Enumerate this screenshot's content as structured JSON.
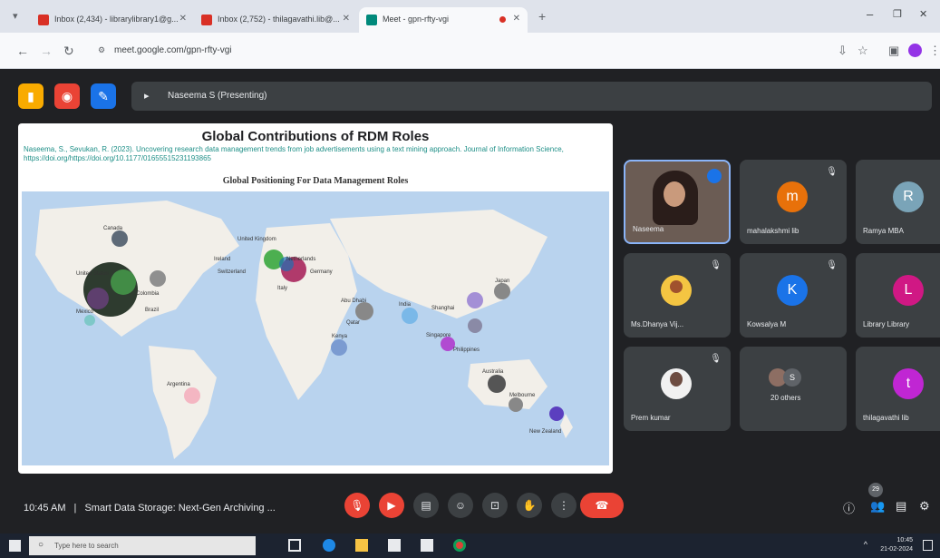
{
  "browser": {
    "tabs": [
      {
        "label": "Inbox (2,434) - librarylibrary1@g...",
        "active": false
      },
      {
        "label": "Inbox (2,752) - thilagavathi.lib@...",
        "active": false
      },
      {
        "label": "Meet - gpn-rfty-vgi",
        "active": true
      }
    ],
    "url": "meet.google.com/gpn-rfty-vgi"
  },
  "meet": {
    "presenter": "Naseema S (Presenting)",
    "meeting_time": "10:45 AM",
    "meeting_title": "Smart Data Storage: Next-Gen Archiving ...",
    "participant_count": "29"
  },
  "slide": {
    "title": "Global Contributions of RDM Roles",
    "citation": "Naseema, S., Sevukan, R. (2023). Uncovering research data management trends from job advertisements using a text mining approach. Journal of Information Science, https://doi.org/https://doi.org/10.1177/01655515231193865",
    "map_title": "Global Positioning For Data Management Roles",
    "map_labels": [
      "Canada",
      "United States",
      "Mexico",
      "Colombia",
      "Brazil",
      "United Kingdom",
      "Ireland",
      "Switzerland",
      "Netherlands",
      "Germany",
      "Italy",
      "Abu Dhabi",
      "Qatar",
      "Kenya",
      "India",
      "Shanghai",
      "Japan",
      "Singapore",
      "Philippines",
      "Australia",
      "Melbourne",
      "New Zealand",
      "Argentina"
    ]
  },
  "participants": [
    {
      "name": "Naseema",
      "initial": "",
      "color": "#ffffff",
      "type": "video"
    },
    {
      "name": "mahalakshmi lib",
      "initial": "m",
      "color": "#e8710a",
      "type": "avatar"
    },
    {
      "name": "Ramya MBA",
      "initial": "R",
      "color": "#7aa4b8",
      "type": "avatar"
    },
    {
      "name": "Ms.Dhanya Vij...",
      "initial": "",
      "color": "#e0e0e0",
      "type": "photo"
    },
    {
      "name": "Kowsalya M",
      "initial": "K",
      "color": "#1a73e8",
      "type": "avatar"
    },
    {
      "name": "Library Library",
      "initial": "L",
      "color": "#d01884",
      "type": "avatar"
    },
    {
      "name": "Prem kumar",
      "initial": "",
      "color": "#e0e0e0",
      "type": "photo"
    },
    {
      "name": "20 others",
      "initial": "S",
      "color": "#5f6368",
      "type": "group"
    },
    {
      "name": "thilagavathi lib",
      "initial": "t",
      "color": "#c026d3",
      "type": "avatar"
    }
  ],
  "taskbar": {
    "search_placeholder": "Type here to search",
    "time": "10:45",
    "date": "21-02-2024"
  }
}
